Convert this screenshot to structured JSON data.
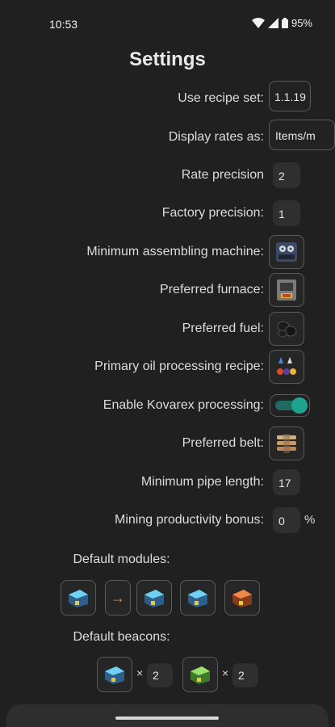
{
  "status": {
    "time": "10:53",
    "battery": "95%"
  },
  "title": "Settings",
  "settings": {
    "recipe_set": {
      "label": "Use recipe set:",
      "value": "1.1.19"
    },
    "display_rates": {
      "label": "Display rates as:",
      "value": "Items/m"
    },
    "rate_precision": {
      "label": "Rate precision",
      "value": "2"
    },
    "factory_precision": {
      "label": "Factory precision:",
      "value": "1"
    },
    "min_assembler": {
      "label": "Minimum assembling machine:",
      "icon": "assembling-machine-icon"
    },
    "furnace": {
      "label": "Preferred furnace:",
      "icon": "electric-furnace-icon"
    },
    "fuel": {
      "label": "Preferred fuel:",
      "icon": "coal-icon"
    },
    "oil": {
      "label": "Primary oil processing recipe:",
      "icon": "oil-processing-icon"
    },
    "kovarex": {
      "label": "Enable Kovarex processing:",
      "enabled": true
    },
    "belt": {
      "label": "Preferred belt:",
      "icon": "transport-belt-icon"
    },
    "pipe": {
      "label": "Minimum pipe length:",
      "value": "17"
    },
    "mining": {
      "label": "Mining productivity bonus:",
      "value": "0",
      "unit": "%"
    }
  },
  "default_modules": {
    "label": "Default modules:",
    "arrow": "→"
  },
  "default_beacons": {
    "label": "Default beacons:",
    "times": "×",
    "items": [
      {
        "icon": "speed-module-icon",
        "count": "2"
      },
      {
        "icon": "efficiency-module-icon",
        "count": "2"
      }
    ]
  },
  "colors": {
    "accent": "#1ea38f",
    "arrow": "#f08a1c",
    "background": "#202020"
  }
}
